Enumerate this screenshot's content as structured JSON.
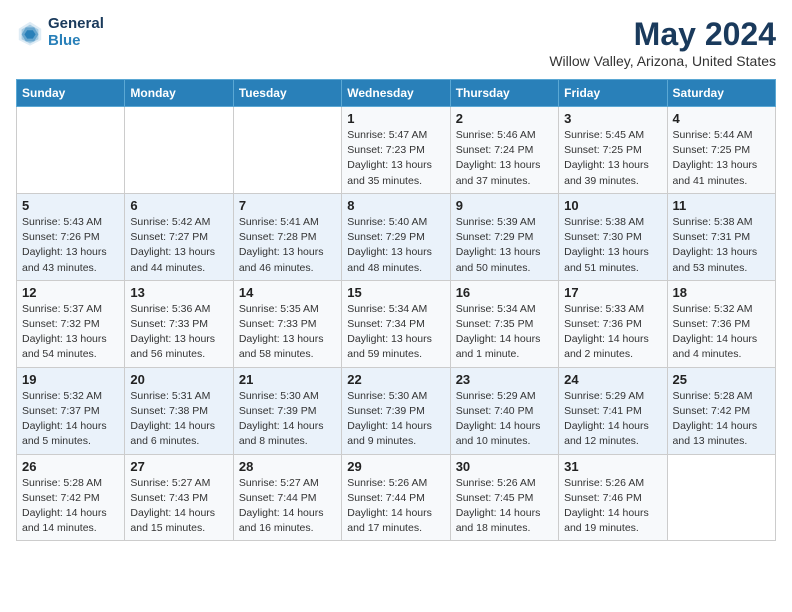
{
  "header": {
    "logo_line1": "General",
    "logo_line2": "Blue",
    "month": "May 2024",
    "location": "Willow Valley, Arizona, United States"
  },
  "weekdays": [
    "Sunday",
    "Monday",
    "Tuesday",
    "Wednesday",
    "Thursday",
    "Friday",
    "Saturday"
  ],
  "weeks": [
    [
      {
        "day": "",
        "info": ""
      },
      {
        "day": "",
        "info": ""
      },
      {
        "day": "",
        "info": ""
      },
      {
        "day": "1",
        "info": "Sunrise: 5:47 AM\nSunset: 7:23 PM\nDaylight: 13 hours\nand 35 minutes."
      },
      {
        "day": "2",
        "info": "Sunrise: 5:46 AM\nSunset: 7:24 PM\nDaylight: 13 hours\nand 37 minutes."
      },
      {
        "day": "3",
        "info": "Sunrise: 5:45 AM\nSunset: 7:25 PM\nDaylight: 13 hours\nand 39 minutes."
      },
      {
        "day": "4",
        "info": "Sunrise: 5:44 AM\nSunset: 7:25 PM\nDaylight: 13 hours\nand 41 minutes."
      }
    ],
    [
      {
        "day": "5",
        "info": "Sunrise: 5:43 AM\nSunset: 7:26 PM\nDaylight: 13 hours\nand 43 minutes."
      },
      {
        "day": "6",
        "info": "Sunrise: 5:42 AM\nSunset: 7:27 PM\nDaylight: 13 hours\nand 44 minutes."
      },
      {
        "day": "7",
        "info": "Sunrise: 5:41 AM\nSunset: 7:28 PM\nDaylight: 13 hours\nand 46 minutes."
      },
      {
        "day": "8",
        "info": "Sunrise: 5:40 AM\nSunset: 7:29 PM\nDaylight: 13 hours\nand 48 minutes."
      },
      {
        "day": "9",
        "info": "Sunrise: 5:39 AM\nSunset: 7:29 PM\nDaylight: 13 hours\nand 50 minutes."
      },
      {
        "day": "10",
        "info": "Sunrise: 5:38 AM\nSunset: 7:30 PM\nDaylight: 13 hours\nand 51 minutes."
      },
      {
        "day": "11",
        "info": "Sunrise: 5:38 AM\nSunset: 7:31 PM\nDaylight: 13 hours\nand 53 minutes."
      }
    ],
    [
      {
        "day": "12",
        "info": "Sunrise: 5:37 AM\nSunset: 7:32 PM\nDaylight: 13 hours\nand 54 minutes."
      },
      {
        "day": "13",
        "info": "Sunrise: 5:36 AM\nSunset: 7:33 PM\nDaylight: 13 hours\nand 56 minutes."
      },
      {
        "day": "14",
        "info": "Sunrise: 5:35 AM\nSunset: 7:33 PM\nDaylight: 13 hours\nand 58 minutes."
      },
      {
        "day": "15",
        "info": "Sunrise: 5:34 AM\nSunset: 7:34 PM\nDaylight: 13 hours\nand 59 minutes."
      },
      {
        "day": "16",
        "info": "Sunrise: 5:34 AM\nSunset: 7:35 PM\nDaylight: 14 hours\nand 1 minute."
      },
      {
        "day": "17",
        "info": "Sunrise: 5:33 AM\nSunset: 7:36 PM\nDaylight: 14 hours\nand 2 minutes."
      },
      {
        "day": "18",
        "info": "Sunrise: 5:32 AM\nSunset: 7:36 PM\nDaylight: 14 hours\nand 4 minutes."
      }
    ],
    [
      {
        "day": "19",
        "info": "Sunrise: 5:32 AM\nSunset: 7:37 PM\nDaylight: 14 hours\nand 5 minutes."
      },
      {
        "day": "20",
        "info": "Sunrise: 5:31 AM\nSunset: 7:38 PM\nDaylight: 14 hours\nand 6 minutes."
      },
      {
        "day": "21",
        "info": "Sunrise: 5:30 AM\nSunset: 7:39 PM\nDaylight: 14 hours\nand 8 minutes."
      },
      {
        "day": "22",
        "info": "Sunrise: 5:30 AM\nSunset: 7:39 PM\nDaylight: 14 hours\nand 9 minutes."
      },
      {
        "day": "23",
        "info": "Sunrise: 5:29 AM\nSunset: 7:40 PM\nDaylight: 14 hours\nand 10 minutes."
      },
      {
        "day": "24",
        "info": "Sunrise: 5:29 AM\nSunset: 7:41 PM\nDaylight: 14 hours\nand 12 minutes."
      },
      {
        "day": "25",
        "info": "Sunrise: 5:28 AM\nSunset: 7:42 PM\nDaylight: 14 hours\nand 13 minutes."
      }
    ],
    [
      {
        "day": "26",
        "info": "Sunrise: 5:28 AM\nSunset: 7:42 PM\nDaylight: 14 hours\nand 14 minutes."
      },
      {
        "day": "27",
        "info": "Sunrise: 5:27 AM\nSunset: 7:43 PM\nDaylight: 14 hours\nand 15 minutes."
      },
      {
        "day": "28",
        "info": "Sunrise: 5:27 AM\nSunset: 7:44 PM\nDaylight: 14 hours\nand 16 minutes."
      },
      {
        "day": "29",
        "info": "Sunrise: 5:26 AM\nSunset: 7:44 PM\nDaylight: 14 hours\nand 17 minutes."
      },
      {
        "day": "30",
        "info": "Sunrise: 5:26 AM\nSunset: 7:45 PM\nDaylight: 14 hours\nand 18 minutes."
      },
      {
        "day": "31",
        "info": "Sunrise: 5:26 AM\nSunset: 7:46 PM\nDaylight: 14 hours\nand 19 minutes."
      },
      {
        "day": "",
        "info": ""
      }
    ]
  ]
}
